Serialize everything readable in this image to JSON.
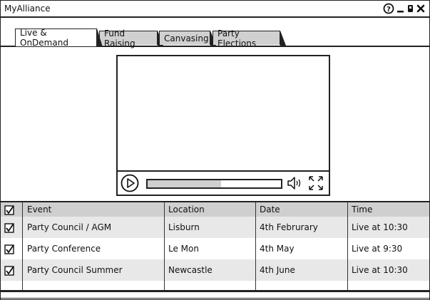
{
  "window": {
    "title": "MyAlliance"
  },
  "icons": {
    "help": "help-icon",
    "minimize": "minimize-icon",
    "restore": "restore-icon",
    "close": "close-icon"
  },
  "tabs": [
    {
      "label": "Live & OnDemand",
      "active": true
    },
    {
      "label": "Fund Raising",
      "active": false
    },
    {
      "label": "Canvasing",
      "active": false
    },
    {
      "label": "Party Elections",
      "active": false
    }
  ],
  "player": {
    "progress": 0.55
  },
  "table": {
    "columns": [
      "Event",
      "Location",
      "Date",
      "Time"
    ],
    "rows": [
      {
        "checked": true,
        "event": "Party Council / AGM",
        "location": "Lisburn",
        "date": "4th Februrary",
        "time": "Live at 10:30"
      },
      {
        "checked": true,
        "event": "Party Conference",
        "location": "Le Mon",
        "date": "4th May",
        "time": "Live at 9:30"
      },
      {
        "checked": true,
        "event": "Party Council Summer",
        "location": "Newcastle",
        "date": "4th June",
        "time": "Live at 10:30"
      }
    ]
  },
  "colors": {
    "border": "#222222",
    "tab_inactive": "#d0d0d0",
    "header_fill": "#cfcfcf",
    "row_shade": "#e8e8e8"
  }
}
